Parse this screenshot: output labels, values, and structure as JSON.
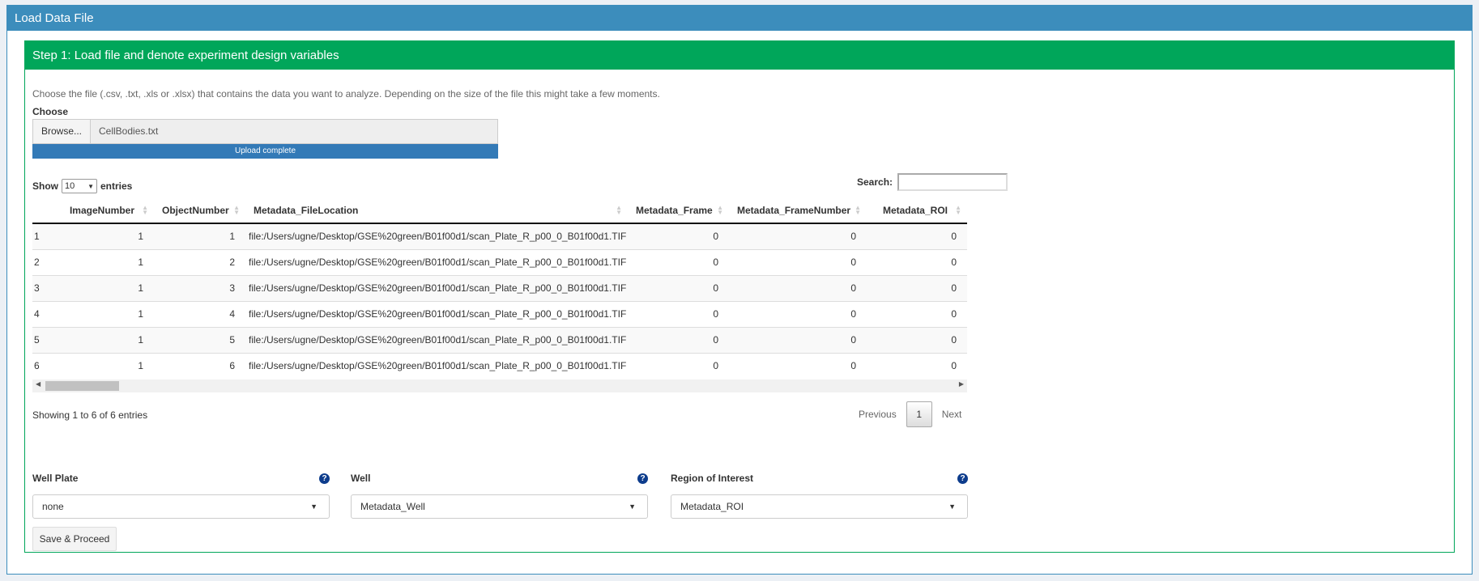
{
  "outer": {
    "title": "Load Data File"
  },
  "step": {
    "title": "Step 1: Load file and denote experiment design variables",
    "description": "Choose the file (.csv, .txt, .xls or .xlsx) that contains the data you want to analyze. Depending on the size of the file this might take a few moments.",
    "file_label": "Choose",
    "browse_label": "Browse...",
    "file_name": "CellBodies.txt",
    "progress_text": "Upload complete",
    "progress_percent": 100
  },
  "table_controls": {
    "show_label": "Show",
    "entries_value": "10",
    "entries_label": "entries",
    "search_label": "Search:",
    "search_value": ""
  },
  "table": {
    "columns": [
      "",
      "ImageNumber",
      "ObjectNumber",
      "Metadata_FileLocation",
      "Metadata_Frame",
      "Metadata_FrameNumber",
      "Metadata_ROI"
    ],
    "rows": [
      [
        "1",
        "1",
        "1",
        "file:/Users/ugne/Desktop/GSE%20green/B01f00d1/scan_Plate_R_p00_0_B01f00d1.TIF",
        "0",
        "0",
        "0"
      ],
      [
        "2",
        "1",
        "2",
        "file:/Users/ugne/Desktop/GSE%20green/B01f00d1/scan_Plate_R_p00_0_B01f00d1.TIF",
        "0",
        "0",
        "0"
      ],
      [
        "3",
        "1",
        "3",
        "file:/Users/ugne/Desktop/GSE%20green/B01f00d1/scan_Plate_R_p00_0_B01f00d1.TIF",
        "0",
        "0",
        "0"
      ],
      [
        "4",
        "1",
        "4",
        "file:/Users/ugne/Desktop/GSE%20green/B01f00d1/scan_Plate_R_p00_0_B01f00d1.TIF",
        "0",
        "0",
        "0"
      ],
      [
        "5",
        "1",
        "5",
        "file:/Users/ugne/Desktop/GSE%20green/B01f00d1/scan_Plate_R_p00_0_B01f00d1.TIF",
        "0",
        "0",
        "0"
      ],
      [
        "6",
        "1",
        "6",
        "file:/Users/ugne/Desktop/GSE%20green/B01f00d1/scan_Plate_R_p00_0_B01f00d1.TIF",
        "0",
        "0",
        "0"
      ]
    ],
    "info": "Showing 1 to 6 of 6 entries",
    "previous": "Previous",
    "current_page": "1",
    "next": "Next"
  },
  "fields": [
    {
      "label": "Well Plate",
      "value": "none"
    },
    {
      "label": "Well",
      "value": "Metadata_Well"
    },
    {
      "label": "Region of Interest",
      "value": "Metadata_ROI"
    }
  ],
  "save_label": "Save & Proceed",
  "colors": {
    "primary": "#3c8dbc",
    "success": "#00a65a",
    "progress": "#337ab7",
    "help": "#0d3c8c"
  }
}
